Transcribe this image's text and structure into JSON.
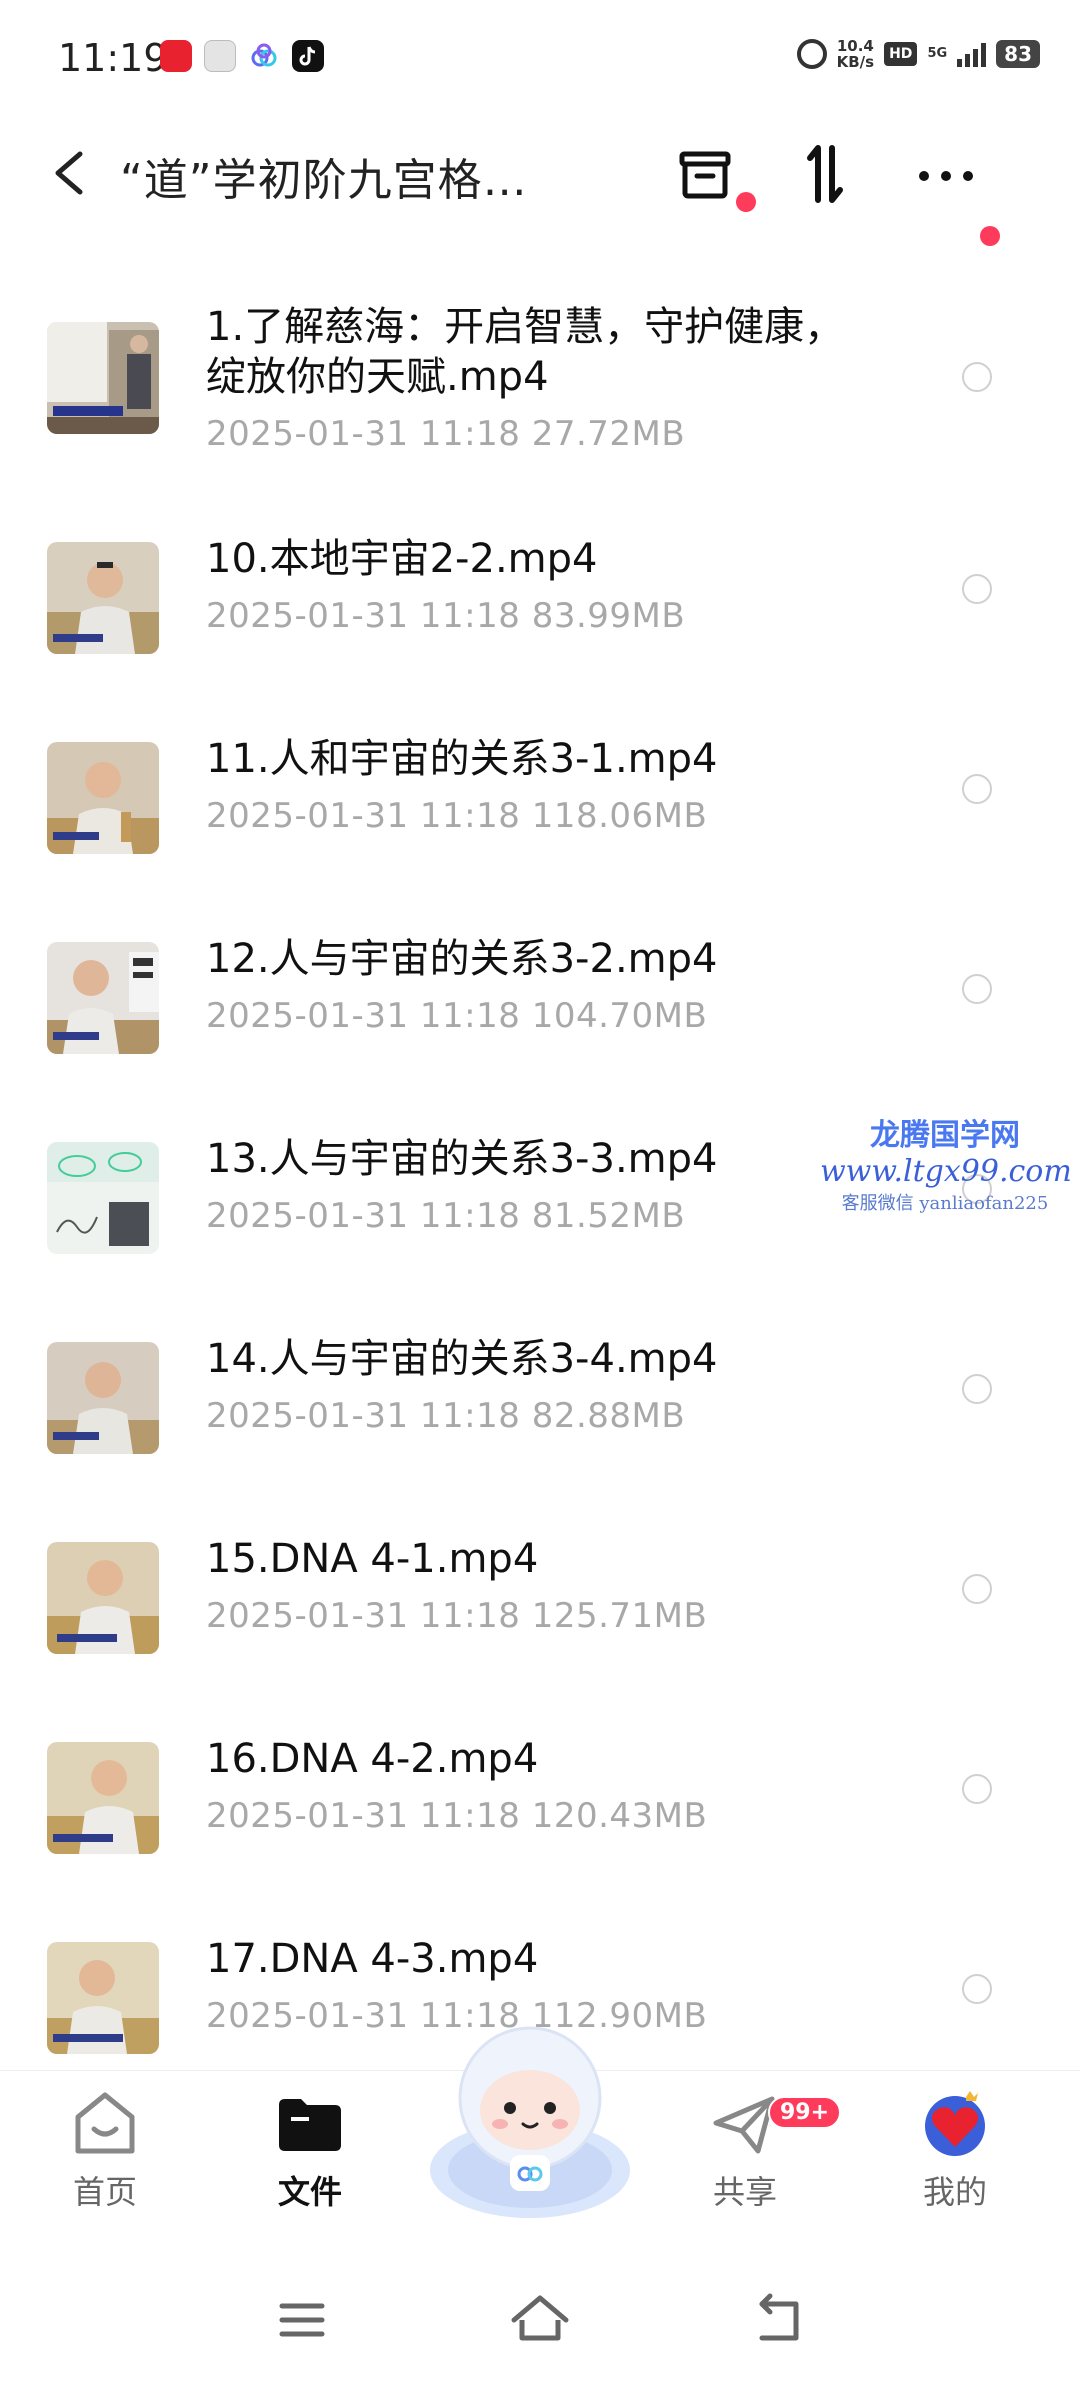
{
  "status_bar": {
    "time": "11:19",
    "net_speed_value": "10.4",
    "net_speed_unit": "KB/s",
    "hd_label": "HD",
    "signal_label": "5G",
    "battery": "83"
  },
  "header": {
    "title": "“道”学初阶九宫格…"
  },
  "files": [
    {
      "name": "1.了解慈海：开启智慧，守护健康，绽放你的天赋.mp4",
      "date": "2025-01-31",
      "time": "11:18",
      "size": "27.72MB"
    },
    {
      "name": "10.本地宇宙2-2.mp4",
      "date": "2025-01-31",
      "time": "11:18",
      "size": "83.99MB"
    },
    {
      "name": "11.人和宇宙的关系3-1.mp4",
      "date": "2025-01-31",
      "time": "11:18",
      "size": "118.06MB"
    },
    {
      "name": "12.人与宇宙的关系3-2.mp4",
      "date": "2025-01-31",
      "time": "11:18",
      "size": "104.70MB"
    },
    {
      "name": "13.人与宇宙的关系3-3.mp4",
      "date": "2025-01-31",
      "time": "11:18",
      "size": "81.52MB"
    },
    {
      "name": "14.人与宇宙的关系3-4.mp4",
      "date": "2025-01-31",
      "time": "11:18",
      "size": "82.88MB"
    },
    {
      "name": "15.DNA 4-1.mp4",
      "date": "2025-01-31",
      "time": "11:18",
      "size": "125.71MB"
    },
    {
      "name": "16.DNA 4-2.mp4",
      "date": "2025-01-31",
      "time": "11:18",
      "size": "120.43MB"
    },
    {
      "name": "17.DNA 4-3.mp4",
      "date": "2025-01-31",
      "time": "11:18",
      "size": "112.90MB"
    }
  ],
  "watermark": {
    "line1": "龙腾国学网",
    "line2": "www.ltgx99.com",
    "line3": "客服微信 yanliaofan225"
  },
  "bottom_nav": {
    "home": "首页",
    "files": "文件",
    "share": "共享",
    "share_badge": "99+",
    "mine": "我的"
  },
  "colors": {
    "accent_red": "#ff3b5c",
    "meta_gray": "#a8a8a8",
    "watermark_blue": "#4a6ee0"
  }
}
